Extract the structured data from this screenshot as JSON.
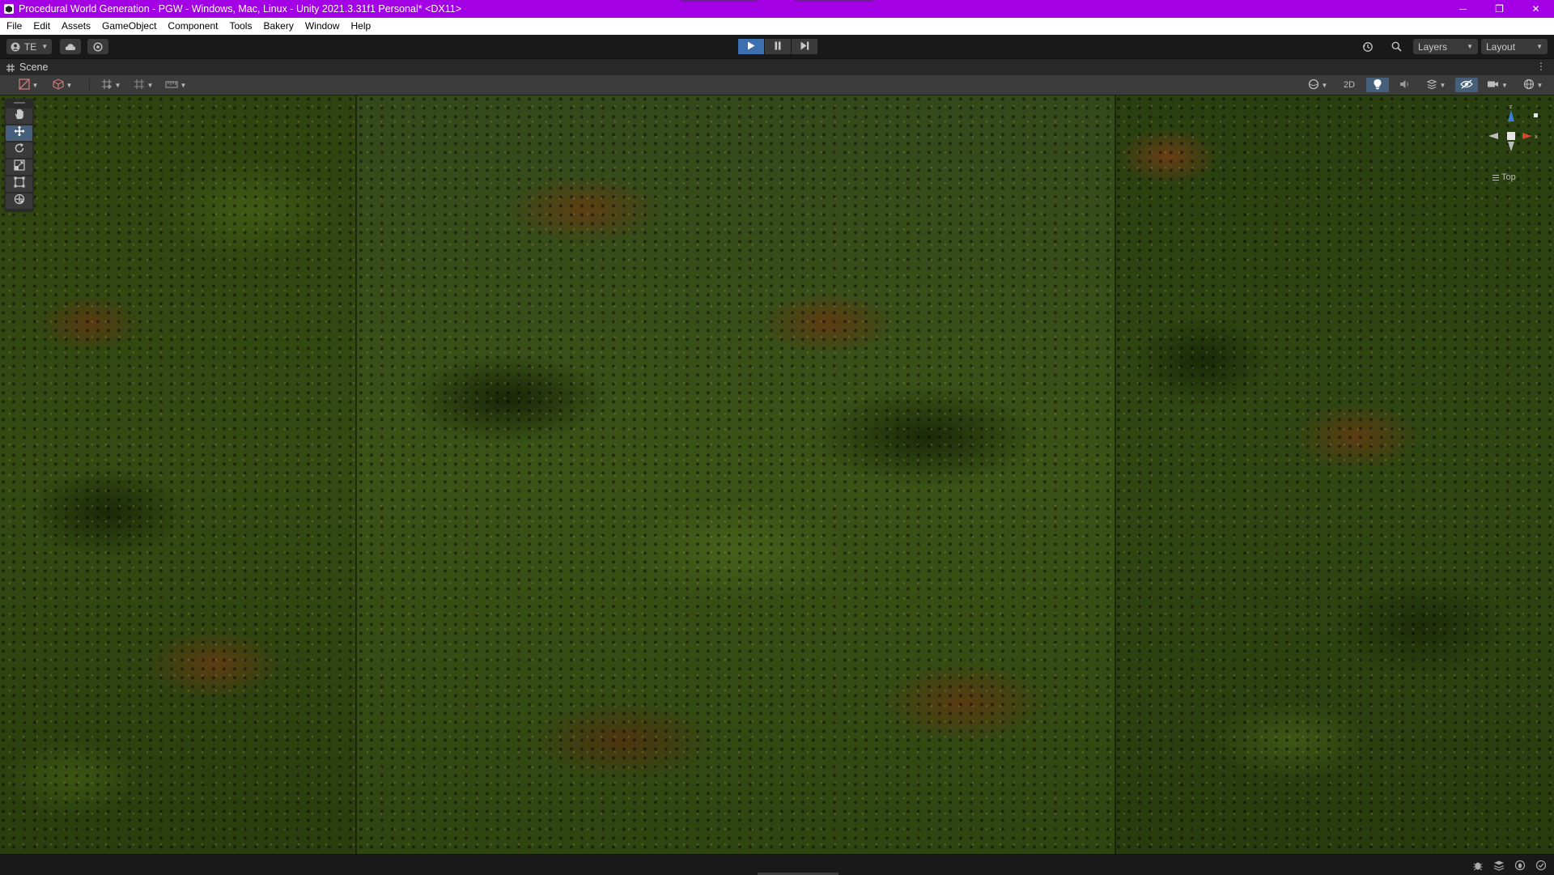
{
  "window": {
    "title": "Procedural World Generation - PGW - Windows, Mac, Linux - Unity 2021.3.31f1 Personal* <DX11>",
    "minimize_glyph": "─",
    "restore_glyph": "❐",
    "close_glyph": "✕"
  },
  "menu": {
    "items": [
      "File",
      "Edit",
      "Assets",
      "GameObject",
      "Component",
      "Tools",
      "Bakery",
      "Window",
      "Help"
    ]
  },
  "toolbar": {
    "account_label": "TE",
    "layers_label": "Layers",
    "layout_label": "Layout",
    "icons": [
      "account-icon",
      "cloud-icon",
      "collab-icon",
      "play-icon",
      "pause-icon",
      "step-icon",
      "history-icon",
      "search-icon"
    ],
    "play_state": "playing"
  },
  "scene": {
    "tab_label": "Scene",
    "toggle_2d_label": "2D",
    "view_label": "Top",
    "gizmo_axes": {
      "x": "x",
      "z": "z"
    },
    "tools": [
      "hand-tool",
      "move-tool",
      "rotate-tool",
      "scale-tool",
      "rect-tool",
      "transform-tool"
    ],
    "active_tool": "move-tool"
  },
  "colors": {
    "titlebar": "#a400e6",
    "play_active": "#3b6fb0",
    "toggle_on": "#46607c",
    "gizmo_x": "#d4482d",
    "gizmo_y": "#8dc63f",
    "gizmo_z": "#3a7fd6"
  }
}
